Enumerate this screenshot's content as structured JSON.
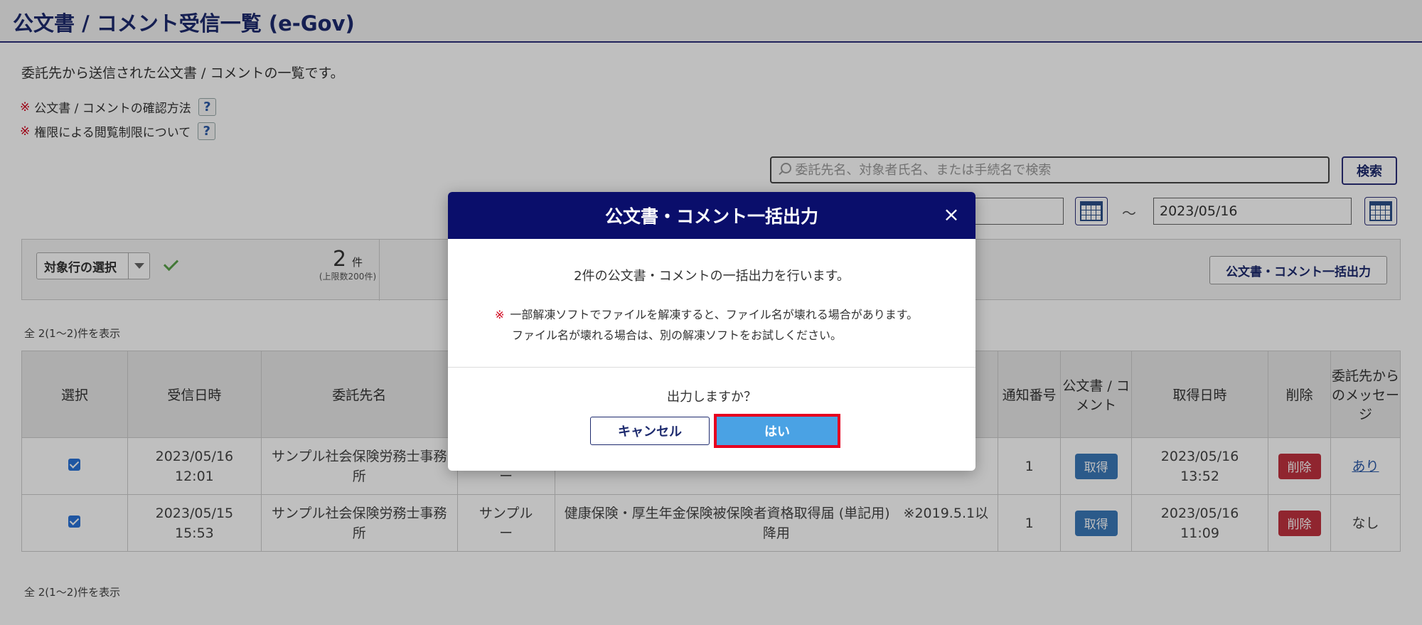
{
  "header": {
    "title": "公文書 / コメント受信一覧 (e-Gov)"
  },
  "intro": {
    "description": "委託先から送信された公文書 / コメントの一覧です。",
    "notes": [
      {
        "mark": "※",
        "text": "公文書 / コメントの確認方法",
        "help": "?"
      },
      {
        "mark": "※",
        "text": "権限による閲覧制限について",
        "help": "?"
      }
    ]
  },
  "search": {
    "placeholder": "委託先名、対象者氏名、または手続名で検索",
    "button_label": "検索",
    "date_to": "2023/05/16",
    "tilde": "～"
  },
  "toolbar": {
    "select_label": "対象行の選択",
    "count": "2",
    "count_unit": "件",
    "limit": "(上限数200件)",
    "bulk_button": "公文書・コメント一括出力"
  },
  "summary_top": "全 2(1～2)件を表示",
  "summary_bottom": "全 2(1～2)件を表示",
  "table": {
    "headers": {
      "select": "選択",
      "received": "受信日時",
      "contractor": "委託先名",
      "notice_no": "通知番号",
      "doc_comment": "公文書 / コメント",
      "acquired": "取得日時",
      "delete": "削除",
      "message": "委託先からのメッセージ"
    },
    "rows": [
      {
        "received_date": "2023/05/16",
        "received_time": "12:01",
        "contractor_1": "サンプル社会保険労務士事務",
        "contractor_2": "所",
        "person_1": "",
        "person_2": "ー",
        "procedure_1": "",
        "procedure_2": "",
        "notice_no": "1",
        "get_label": "取得",
        "acquired_date": "2023/05/16",
        "acquired_time": "13:52",
        "delete_label": "削除",
        "message": "あり"
      },
      {
        "received_date": "2023/05/15",
        "received_time": "15:53",
        "contractor_1": "サンプル社会保険労務士事務",
        "contractor_2": "所",
        "person_1": "サンプル",
        "person_2": "ー",
        "procedure_1": "健康保険・厚生年金保険被保険者資格取得届 (単記用)　※2019.5.1以",
        "procedure_2": "降用",
        "notice_no": "1",
        "get_label": "取得",
        "acquired_date": "2023/05/16",
        "acquired_time": "11:09",
        "delete_label": "削除",
        "message": "なし"
      }
    ]
  },
  "modal": {
    "title": "公文書・コメント一括出力",
    "close": "×",
    "message": "2件の公文書・コメントの一括出力を行います。",
    "warning_mark": "※",
    "warning_line1": "一部解凍ソフトでファイルを解凍すると、ファイル名が壊れる場合があります。",
    "warning_line2": "ファイル名が壊れる場合は、別の解凍ソフトをお試しください。",
    "question": "出力しますか？",
    "cancel_label": "キャンセル",
    "yes_label": "はい"
  }
}
